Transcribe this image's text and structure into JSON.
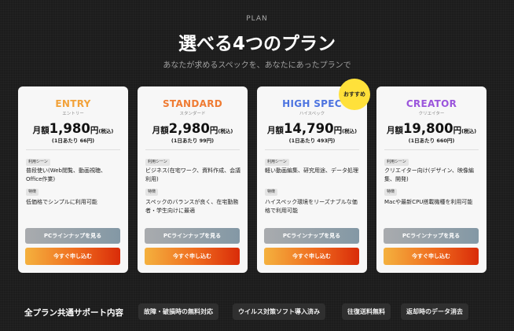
{
  "header": {
    "eyebrow": "PLAN",
    "title": "選べる4つのプラン",
    "subtitle": "あなたが求めるスペックを、あなたにあったプランで"
  },
  "recommend_badge": "おすすめ",
  "labels": {
    "price_prefix": "月額",
    "yen": "円",
    "tax": "(税込)",
    "use_tag": "利用シーン",
    "feature_tag": "特徴",
    "lineup_button": "PCラインナップを見る",
    "apply_button": "今すぐ申し込む"
  },
  "plans": [
    {
      "name": "ENTRY",
      "kana": "エントリー",
      "color": "#f2a23a",
      "price": "1,980",
      "per_day": "(1日あたり 66円)",
      "use": "普段使い(Web閲覧、動画視聴、Office作業)",
      "feature": "低価格でシンプルに利用可能"
    },
    {
      "name": "STANDARD",
      "kana": "スタンダード",
      "color": "#ef7b33",
      "price": "2,980",
      "per_day": "(1日あたり 99円)",
      "use": "ビジネス(在宅ワーク、資料作成、会議利用)",
      "feature": "スペックのバランスが良く、在宅勤務者・学生向けに最適"
    },
    {
      "name": "HIGH SPEC",
      "kana": "ハイスペック",
      "color": "#4d74e0",
      "price": "14,790",
      "per_day": "(1日あたり 493円)",
      "use": "軽い動画編集、研究用途、データ処理",
      "feature": "ハイスペック環境をリーズナブルな価格で利用可能"
    },
    {
      "name": "CREATOR",
      "kana": "クリエイター",
      "color": "#9b55dc",
      "price": "19,800",
      "per_day": "(1日あたり 660円)",
      "use": "クリエイター向け(デザイン、映像編集、開発)",
      "feature": "Macや最新CPU搭載機種を利用可能"
    }
  ],
  "support": {
    "title": "全プラン共通サポート内容",
    "items": [
      "故障・破損時の無料対応",
      "ウイルス対策ソフト導入済み",
      "往復送料無料",
      "返却時のデータ消去"
    ]
  }
}
